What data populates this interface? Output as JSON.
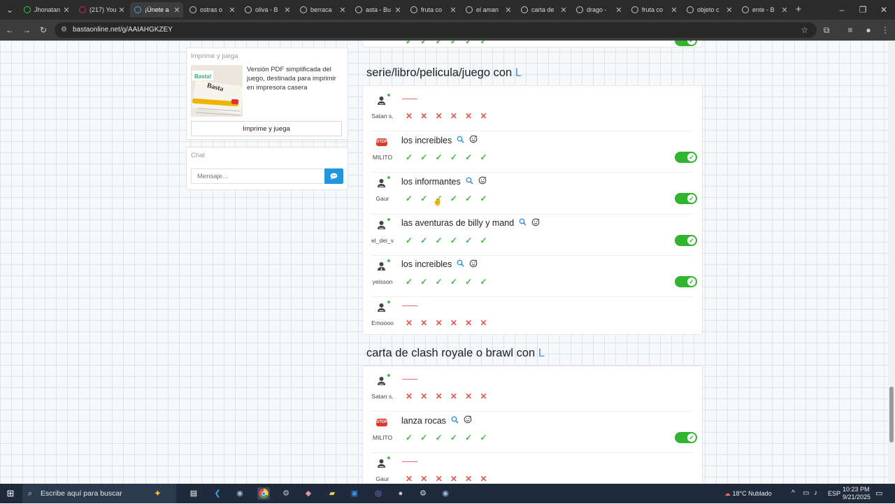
{
  "browser": {
    "tabs": [
      {
        "label": "Jhonatan",
        "active": false,
        "color": "#2ecc40"
      },
      {
        "label": "(217) You",
        "active": false,
        "color": "#e0245e"
      },
      {
        "label": "¡Únete a",
        "active": true,
        "color": "#4aa3df"
      },
      {
        "label": "ostras o",
        "active": false,
        "color": "#c8c8c8"
      },
      {
        "label": "oliva - B",
        "active": false,
        "color": "#c8c8c8"
      },
      {
        "label": "berraca",
        "active": false,
        "color": "#c8c8c8"
      },
      {
        "label": "asta - Bu",
        "active": false,
        "color": "#c8c8c8"
      },
      {
        "label": "fruta co",
        "active": false,
        "color": "#c8c8c8"
      },
      {
        "label": "el aman",
        "active": false,
        "color": "#c8c8c8"
      },
      {
        "label": "carta de",
        "active": false,
        "color": "#c8c8c8"
      },
      {
        "label": "drago -",
        "active": false,
        "color": "#c8c8c8"
      },
      {
        "label": "fruta co",
        "active": false,
        "color": "#c8c8c8"
      },
      {
        "label": "objeto c",
        "active": false,
        "color": "#c8c8c8"
      },
      {
        "label": "ente - B",
        "active": false,
        "color": "#c8c8c8"
      }
    ],
    "url": "bastaonline.net/g/AAIAHGKZEY",
    "new_tab_icon": "plus-icon"
  },
  "sidebar": {
    "print_panel": {
      "title": "Imprime y juega",
      "description": "Versión PDF simplificada del juego, destinada para imprimir en impresora casera",
      "button_label": "Imprime y juega"
    },
    "chat_panel": {
      "title": "Chat",
      "input_placeholder": "Mensaje...",
      "send_icon": "chat-bubble-icon"
    }
  },
  "sections": [
    {
      "title": "serie/libro/pelicula/juego con",
      "letter": "L",
      "rows": [
        {
          "user": "Satan s.",
          "avatar": "person",
          "answer": "",
          "marks": [
            "x",
            "x",
            "x",
            "x",
            "x",
            "x"
          ],
          "accepted": false
        },
        {
          "user": "MILITO",
          "avatar": "stop",
          "answer": "los increibles",
          "marks": [
            "v",
            "v",
            "v",
            "v",
            "v",
            "v"
          ],
          "accepted": true
        },
        {
          "user": "Gaur",
          "avatar": "person",
          "answer": "los informantes",
          "marks": [
            "v",
            "v",
            "v",
            "v",
            "v",
            "v"
          ],
          "accepted": true
        },
        {
          "user": "el_dei_v",
          "avatar": "person",
          "answer": "las aventuras de billy y mand",
          "marks": [
            "v",
            "v",
            "v",
            "v",
            "v",
            "v"
          ],
          "accepted": true
        },
        {
          "user": "yeisson",
          "avatar": "person-tie",
          "answer": "los increibles",
          "marks": [
            "v",
            "v",
            "v",
            "v",
            "v",
            "v"
          ],
          "accepted": true
        },
        {
          "user": "Emoooo",
          "avatar": "person",
          "answer": "",
          "marks": [
            "x",
            "x",
            "x",
            "x",
            "x",
            "x"
          ],
          "accepted": false
        }
      ]
    },
    {
      "title": "carta de clash royale o brawl con",
      "letter": "L",
      "rows": [
        {
          "user": "Satan s.",
          "avatar": "person",
          "answer": "",
          "marks": [
            "x",
            "x",
            "x",
            "x",
            "x",
            "x"
          ],
          "accepted": false
        },
        {
          "user": "MILITO",
          "avatar": "stop",
          "answer": "lanza rocas",
          "marks": [
            "v",
            "v",
            "v",
            "v",
            "v",
            "v"
          ],
          "accepted": true
        },
        {
          "user": "Gaur",
          "avatar": "person",
          "answer": "",
          "marks": [
            "x",
            "x",
            "x",
            "x",
            "x",
            "x"
          ],
          "accepted": false
        }
      ]
    }
  ],
  "taskbar": {
    "search_placeholder": "Escribe aquí para buscar",
    "weather": "18°C Nublado",
    "language": "ESP",
    "time": "10:23 PM",
    "date": "9/21/2025"
  }
}
